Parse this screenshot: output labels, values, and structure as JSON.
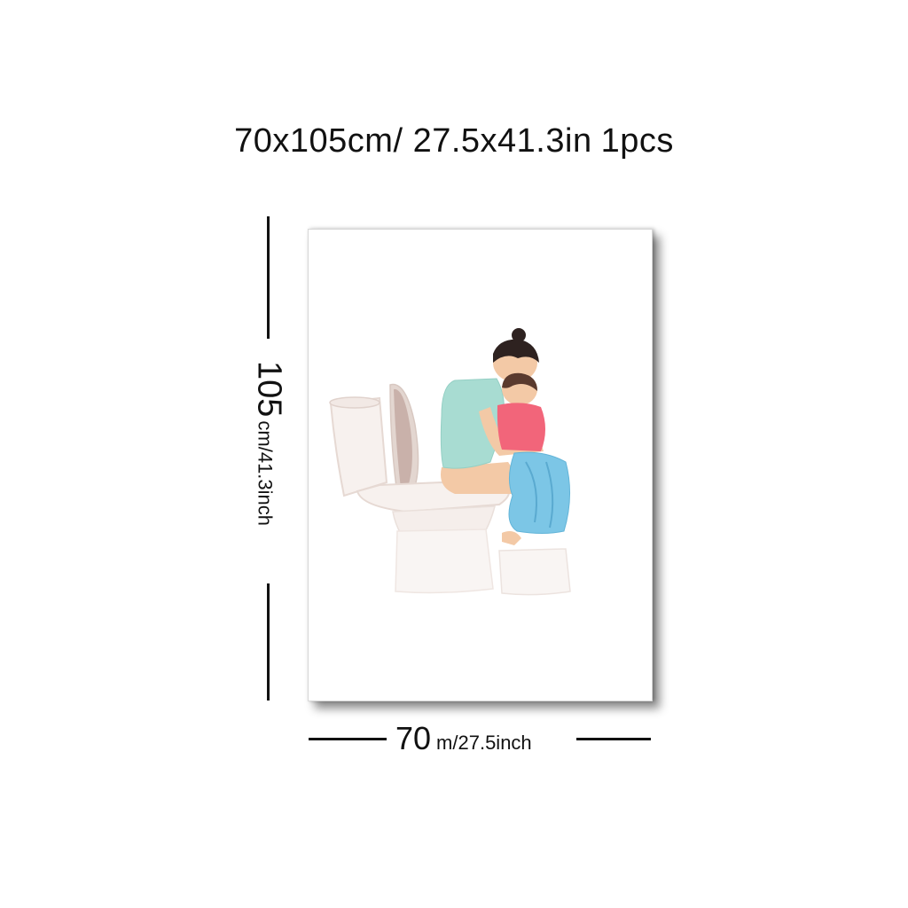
{
  "title": {
    "size": "70x105cm/ 27.5x41.3in",
    "qty": "1pcs"
  },
  "height_dim": {
    "value": "105",
    "unit": "cm/41.3inch"
  },
  "width_dim": {
    "value": "70",
    "unit": "m/27.5inch"
  },
  "artwork": {
    "subject": "mother-and-child-on-toilet-illustration",
    "colors": {
      "shirt_teal": "#a8dcd2",
      "child_shirt_pink": "#f2657a",
      "pants_blue": "#7cc6e6",
      "skin": "#f3c9a6",
      "hair": "#2e2220",
      "toilet": "#f7f1ee",
      "toilet_shade": "#e3d6d0"
    }
  }
}
